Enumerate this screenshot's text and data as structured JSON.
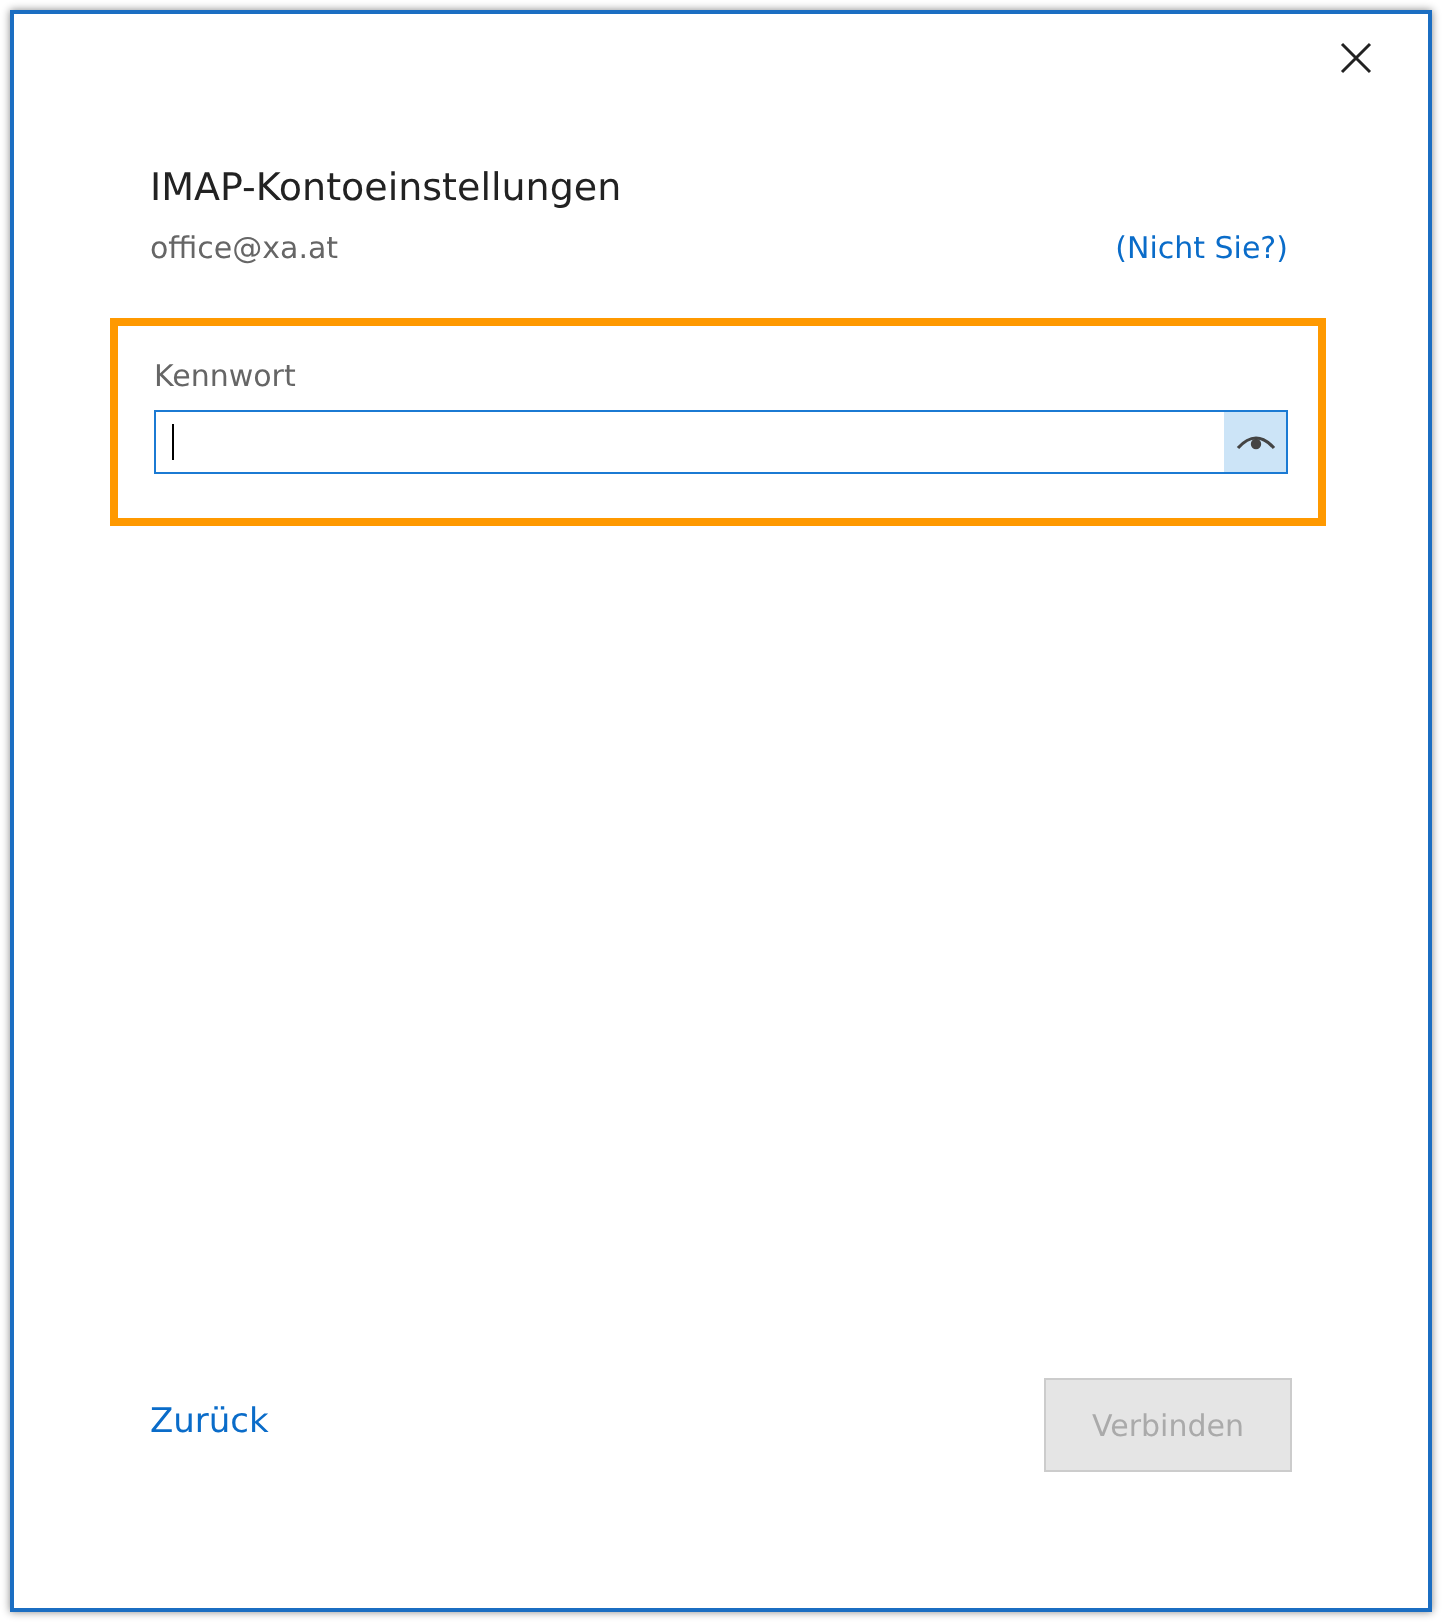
{
  "dialog": {
    "title": "IMAP-Kontoeinstellungen",
    "account": "office@xa.at",
    "not_you_link": "(Nicht Sie?)"
  },
  "password_field": {
    "label": "Kennwort",
    "highlighted": true,
    "focused": true
  },
  "footer": {
    "back_link": "Zurück",
    "connect_button": {
      "label": "Verbinden",
      "disabled": true
    }
  }
}
